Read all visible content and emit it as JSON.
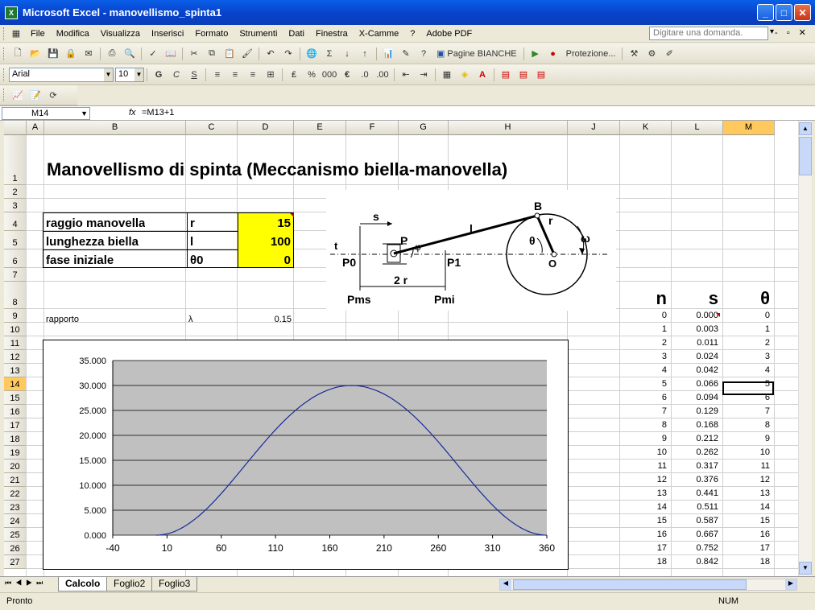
{
  "window": {
    "title": "Microsoft Excel - manovellismo_spinta1"
  },
  "menu": [
    "File",
    "Modifica",
    "Visualizza",
    "Inserisci",
    "Formato",
    "Strumenti",
    "Dati",
    "Finestra",
    "X-Camme",
    "?",
    "Adobe PDF"
  ],
  "help_placeholder": "Digitare una domanda.",
  "toolbar": {
    "pagine": "Pagine BIANCHE",
    "protezione": "Protezione...",
    "font": "Arial",
    "size": "10"
  },
  "formula": {
    "cell": "M14",
    "fx": "fx",
    "value": "=M13+1"
  },
  "columns": [
    "A",
    "B",
    "C",
    "D",
    "E",
    "F",
    "G",
    "H",
    "J",
    "K",
    "L",
    "M"
  ],
  "rows": [
    "1",
    "2",
    "3",
    "4",
    "5",
    "6",
    "7",
    "8",
    "9",
    "10",
    "11",
    "12",
    "13",
    "14",
    "15",
    "16",
    "17",
    "18",
    "19",
    "20",
    "21",
    "22",
    "23",
    "24",
    "25",
    "26",
    "27"
  ],
  "sheet": {
    "title": "Manovellismo di spinta (Meccanismo biella-manovella)",
    "params": [
      {
        "label": "raggio manovella",
        "sym": "r",
        "value": "15"
      },
      {
        "label": "lunghezza biella",
        "sym": "l",
        "value": "100"
      },
      {
        "label": "fase iniziale",
        "sym": "θ0",
        "value": "0"
      }
    ],
    "rapporto": {
      "label": "rapporto",
      "sym": "λ",
      "value": "0.15"
    },
    "table_headers": {
      "n": "n",
      "s": "s",
      "theta": "θ"
    },
    "table": [
      [
        "0",
        "0.000",
        "0"
      ],
      [
        "1",
        "0.003",
        "1"
      ],
      [
        "2",
        "0.011",
        "2"
      ],
      [
        "3",
        "0.024",
        "3"
      ],
      [
        "4",
        "0.042",
        "4"
      ],
      [
        "5",
        "0.066",
        "5"
      ],
      [
        "6",
        "0.094",
        "6"
      ],
      [
        "7",
        "0.129",
        "7"
      ],
      [
        "8",
        "0.168",
        "8"
      ],
      [
        "9",
        "0.212",
        "9"
      ],
      [
        "10",
        "0.262",
        "10"
      ],
      [
        "11",
        "0.317",
        "11"
      ],
      [
        "12",
        "0.376",
        "12"
      ],
      [
        "13",
        "0.441",
        "13"
      ],
      [
        "14",
        "0.511",
        "14"
      ],
      [
        "15",
        "0.587",
        "15"
      ],
      [
        "16",
        "0.667",
        "16"
      ],
      [
        "17",
        "0.752",
        "17"
      ],
      [
        "18",
        "0.842",
        "18"
      ]
    ]
  },
  "diagram": {
    "s": "s",
    "P": "P",
    "l": "l",
    "B": "B",
    "r": "r",
    "theta": "θ",
    "phi": "φ",
    "omega": "ω",
    "O": "O",
    "P0": "P0",
    "P1": "P1",
    "twor": "2 r",
    "Pms": "Pms",
    "Pmi": "Pmi",
    "t": "t"
  },
  "chart_data": {
    "type": "line",
    "title": "",
    "xlabel": "",
    "ylabel": "",
    "xlim": [
      -40,
      360
    ],
    "ylim": [
      0,
      35
    ],
    "x_ticks": [
      "-40",
      "10",
      "60",
      "110",
      "160",
      "210",
      "260",
      "310",
      "360"
    ],
    "y_ticks": [
      "0.000",
      "5.000",
      "10.000",
      "15.000",
      "20.000",
      "25.000",
      "30.000",
      "35.000"
    ],
    "series": [
      {
        "x": [
          0,
          30,
          60,
          90,
          120,
          150,
          180,
          210,
          240,
          270,
          300,
          330,
          360
        ],
        "values": [
          0,
          2.63,
          9.8,
          18.3,
          25.3,
          29.8,
          30,
          25.3,
          18.3,
          9.8,
          2.6,
          0.5,
          0
        ]
      }
    ],
    "line_color": "#1a2a9a",
    "plot_bg": "#c0c0c0",
    "grid": true
  },
  "tabs": [
    "Calcolo",
    "Foglio2",
    "Foglio3"
  ],
  "status": {
    "left": "Pronto",
    "num": "NUM"
  }
}
